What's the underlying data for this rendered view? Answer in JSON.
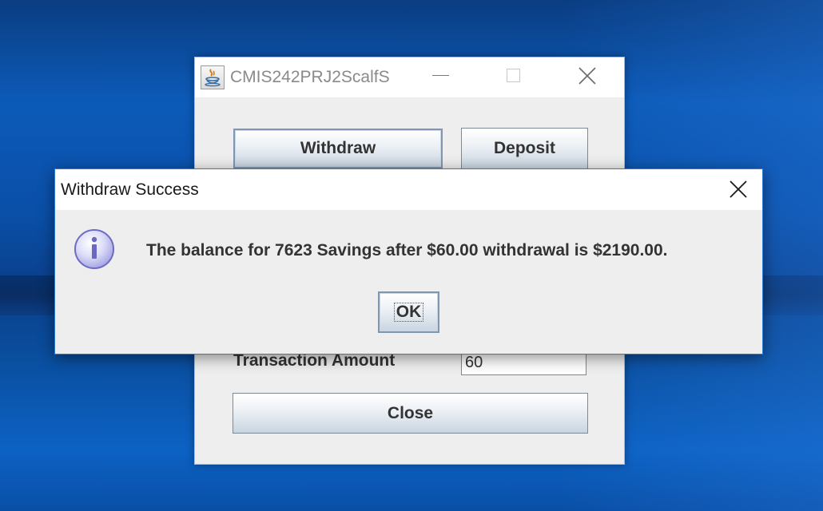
{
  "main_window": {
    "title": "CMIS242PRJ2ScalfS",
    "buttons": {
      "withdraw": "Withdraw",
      "deposit": "Deposit",
      "close": "Close"
    },
    "transaction_amount_label": "Transaction Amount",
    "transaction_amount_value": "60"
  },
  "dialog": {
    "title": "Withdraw Success",
    "message": "The balance for 7623 Savings after $60.00 withdrawal is $2190.00.",
    "ok_label": "OK",
    "icon": "info-icon"
  },
  "colors": {
    "desktop": "#0c5ab8",
    "dialog_border": "#2a7ad6",
    "window_bg": "#eeeeee",
    "button_text": "#333333"
  }
}
